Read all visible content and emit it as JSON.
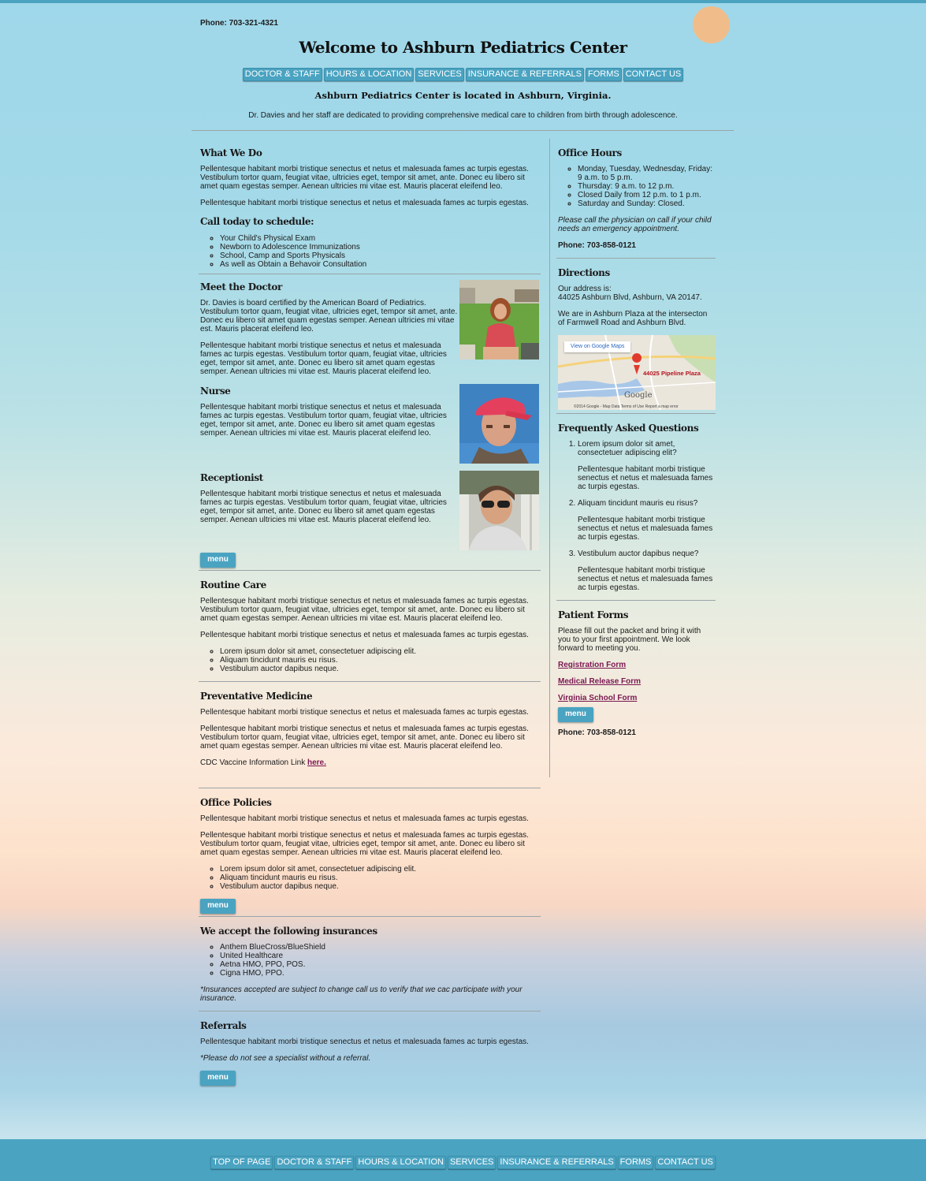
{
  "header": {
    "phone": "Phone: 703-321-4321",
    "title": "Welcome to Ashburn Pediatrics Center",
    "located": "Ashburn Pediatrics Center is located in Ashburn, Virginia.",
    "tagline": "Dr. Davies and her staff are dedicated to providing comprehensive medical care to children from birth through adolescence."
  },
  "nav": [
    "DOCTOR & STAFF",
    "HOURS & LOCATION",
    "SERVICES",
    "INSURANCE & REFERRALS",
    "FORMS",
    "CONTACT US"
  ],
  "footer_nav": [
    "TOP OF PAGE",
    "DOCTOR & STAFF",
    "HOURS & LOCATION",
    "SERVICES",
    "INSURANCE & REFERRALS",
    "FORMS",
    "CONTACT US"
  ],
  "menu_label": "menu",
  "main": {
    "what_we_do": {
      "title": "What We Do",
      "p1": "Pellentesque habitant morbi tristique senectus et netus et malesuada fames ac turpis egestas. Vestibulum tortor quam, feugiat vitae, ultricies eget, tempor sit amet, ante. Donec eu libero sit amet quam egestas semper. Aenean ultricies mi vitae est. Mauris placerat eleifend leo.",
      "p2": "Pellentesque habitant morbi tristique senectus et netus et malesuada fames ac turpis egestas.",
      "schedule_title": "Call today to schedule:",
      "schedule_items": [
        "Your Child's Physical Exam",
        "Newborn to Adolescence Immunizations",
        "School, Camp and Sports Physicals",
        "As well as Obtain a Behavoir Consultation"
      ]
    },
    "doctor": {
      "title": "Meet the Doctor",
      "p1": "Dr. Davies is board certified by the American Board of Pediatrics. Vestibulum tortor quam, feugiat vitae, ultricies eget, tempor sit amet, ante. Donec eu libero sit amet quam egestas semper. Aenean ultricies mi vitae est. Mauris placerat eleifend leo.",
      "p2": "Pellentesque habitant morbi tristique senectus et netus et malesuada fames ac turpis egestas. Vestibulum tortor quam, feugiat vitae, ultricies eget, tempor sit amet, ante. Donec eu libero sit amet quam egestas semper. Aenean ultricies mi vitae est. Mauris placerat eleifend leo."
    },
    "nurse": {
      "title": "Nurse",
      "p1": "Pellentesque habitant morbi tristique senectus et netus et malesuada fames ac turpis egestas. Vestibulum tortor quam, feugiat vitae, ultricies eget, tempor sit amet, ante. Donec eu libero sit amet quam egestas semper. Aenean ultricies mi vitae est. Mauris placerat eleifend leo."
    },
    "receptionist": {
      "title": "Receptionist",
      "p1": "Pellentesque habitant morbi tristique senectus et netus et malesuada fames ac turpis egestas. Vestibulum tortor quam, feugiat vitae, ultricies eget, tempor sit amet, ante. Donec eu libero sit amet quam egestas semper. Aenean ultricies mi vitae est. Mauris placerat eleifend leo."
    },
    "routine": {
      "title": "Routine Care",
      "p1": "Pellentesque habitant morbi tristique senectus et netus et malesuada fames ac turpis egestas. Vestibulum tortor quam, feugiat vitae, ultricies eget, tempor sit amet, ante. Donec eu libero sit amet quam egestas semper. Aenean ultricies mi vitae est. Mauris placerat eleifend leo.",
      "p2": "Pellentesque habitant morbi tristique senectus et netus et malesuada fames ac turpis egestas.",
      "items": [
        "Lorem ipsum dolor sit amet, consectetuer adipiscing elit.",
        "Aliquam tincidunt mauris eu risus.",
        "Vestibulum auctor dapibus neque."
      ]
    },
    "preventative": {
      "title": "Preventative Medicine",
      "p1": "Pellentesque habitant morbi tristique senectus et netus et malesuada fames ac turpis egestas.",
      "p2": "Pellentesque habitant morbi tristique senectus et netus et malesuada fames ac turpis egestas. Vestibulum tortor quam, feugiat vitae, ultricies eget, tempor sit amet, ante. Donec eu libero sit amet quam egestas semper. Aenean ultricies mi vitae est. Mauris placerat eleifend leo.",
      "cdc_text": "CDC Vaccine Information Link",
      "cdc_link": "here."
    },
    "policies": {
      "title": "Office Policies",
      "p1": "Pellentesque habitant morbi tristique senectus et netus et malesuada fames ac turpis egestas.",
      "p2": "Pellentesque habitant morbi tristique senectus et netus et malesuada fames ac turpis egestas. Vestibulum tortor quam, feugiat vitae, ultricies eget, tempor sit amet, ante. Donec eu libero sit amet quam egestas semper. Aenean ultricies mi vitae est. Mauris placerat eleifend leo.",
      "items": [
        "Lorem ipsum dolor sit amet, consectetuer adipiscing elit.",
        "Aliquam tincidunt mauris eu risus.",
        "Vestibulum auctor dapibus neque."
      ]
    },
    "insurances": {
      "title": "We accept the following insurances",
      "items": [
        "Anthem BlueCross/BlueShield",
        "United Healthcare",
        "Aetna HMO, PPO, POS.",
        "Cigna HMO, PPO."
      ],
      "note": "*Insurances accepted are subject to change call us to verify that we cac participate with your insurance."
    },
    "referrals": {
      "title": "Referrals",
      "p1": "Pellentesque habitant morbi tristique senectus et netus et malesuada fames ac turpis egestas.",
      "note": "*Please do not see a specialist without a referral."
    }
  },
  "side": {
    "hours": {
      "title": "Office Hours",
      "items": [
        "Monday, Tuesday, Wednesday, Friday: 9 a.m. to 5 p.m.",
        "Thursday: 9 a.m. to 12 p.m.",
        "Closed Daily from 12 p.m. to 1 p.m.",
        "Saturday and Sunday: Closed."
      ],
      "note": "Please call the physician on call if your child needs an emergency appointment.",
      "phone": "Phone: 703-858-0121"
    },
    "directions": {
      "title": "Directions",
      "address_label": "Our address is:",
      "address": "44025 Ashburn Blvd, Ashburn, VA 20147.",
      "description": "We are in Ashburn Plaza at the intersecton of Farmwell Road and Ashburn Blvd.",
      "map_button": "View on Google Maps",
      "map_pin_label": "44025 Pipeline Plaza",
      "map_logo": "Google",
      "map_copyright": "©2014 Google - Map Data    Terms of Use    Report a map error"
    },
    "faq": {
      "title": "Frequently Asked Questions",
      "items": [
        {
          "q": "Lorem ipsum dolor sit amet, consectetuer adipiscing elit?",
          "a": "Pellentesque habitant morbi tristique senectus et netus et malesuada fames ac turpis egestas."
        },
        {
          "q": "Aliquam tincidunt mauris eu risus?",
          "a": "Pellentesque habitant morbi tristique senectus et netus et malesuada fames ac turpis egestas."
        },
        {
          "q": "Vestibulum auctor dapibus neque?",
          "a": "Pellentesque habitant morbi tristique senectus et netus et malesuada fames ac turpis egestas."
        }
      ]
    },
    "forms": {
      "title": "Patient Forms",
      "intro": "Please fill out the packet and bring it with you to your first appointment. We look forward to meeting you.",
      "links": [
        "Registration Form",
        "Medical Release Form",
        "Virginia School Form"
      ],
      "phone": "Phone: 703-858-0121"
    }
  }
}
